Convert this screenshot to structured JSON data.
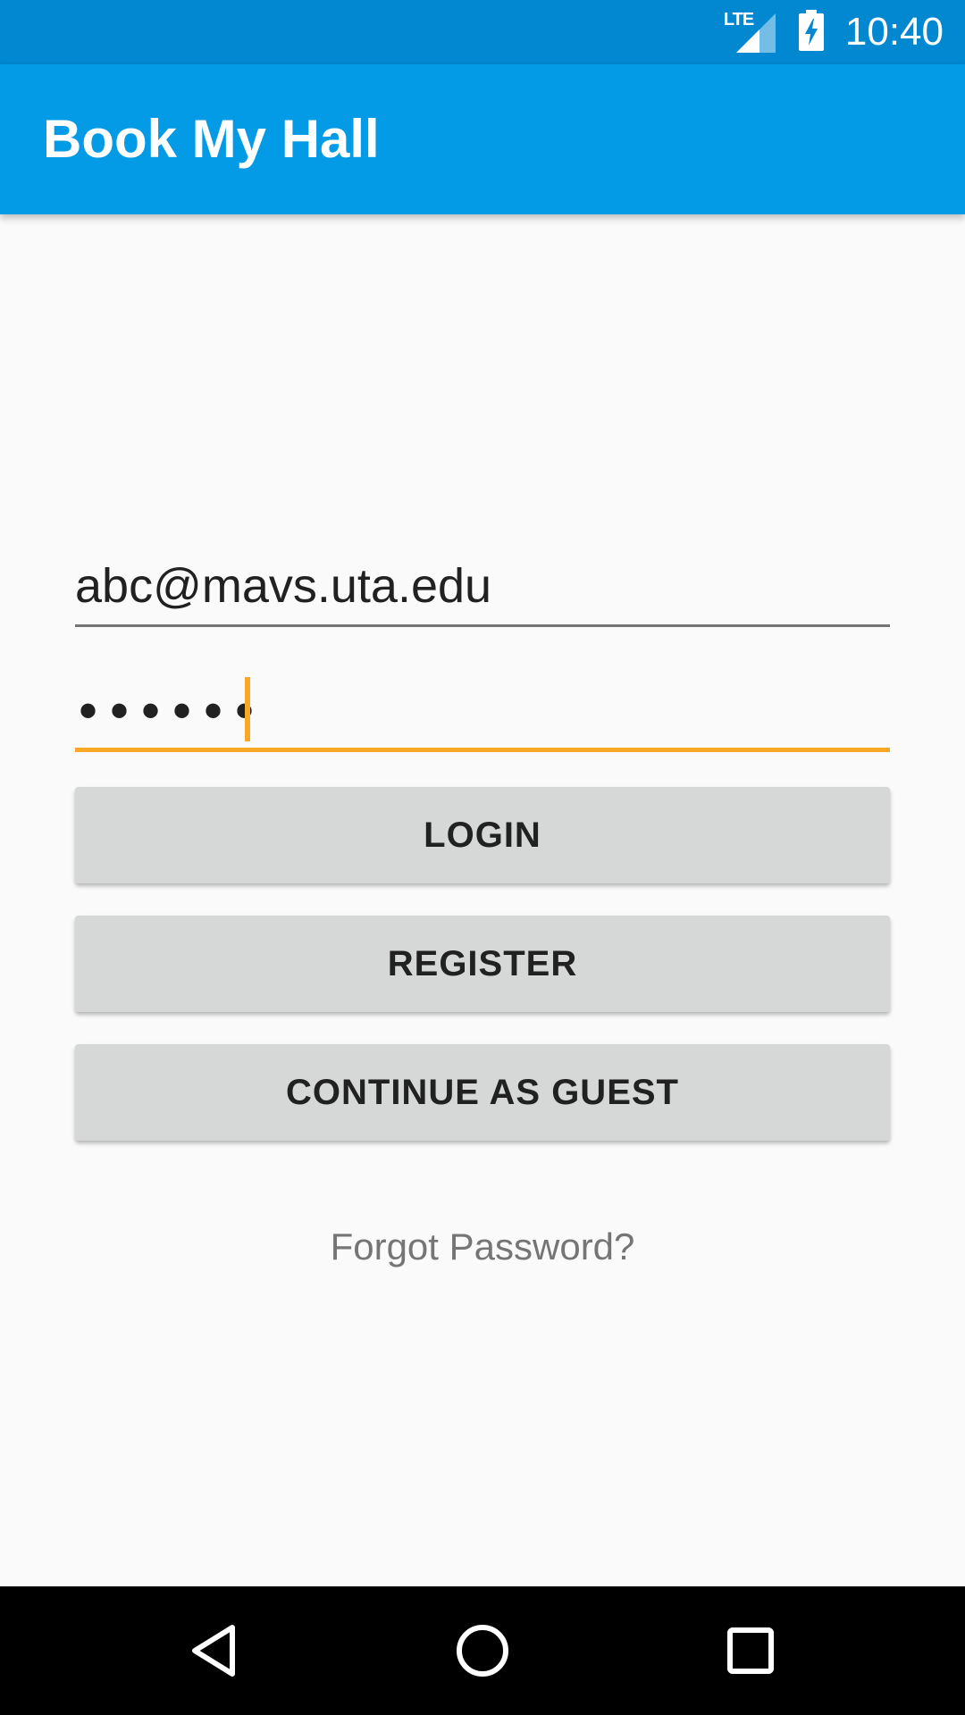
{
  "status_bar": {
    "network_label": "LTE",
    "time": "10:40",
    "icons": [
      "lte-signal-icon",
      "battery-charging-icon"
    ]
  },
  "app_bar": {
    "title": "Book My Hall"
  },
  "login_form": {
    "email_value": "abc@mavs.uta.edu",
    "password_masked": "••••••",
    "buttons": {
      "login": "LOGIN",
      "register": "REGISTER",
      "guest": "CONTINUE AS GUEST"
    },
    "forgot_password": "Forgot Password?"
  },
  "nav_bar": {
    "icons": [
      "back-icon",
      "home-icon",
      "recents-icon"
    ]
  },
  "colors": {
    "status_bar": "#0288d1",
    "app_bar": "#039be5",
    "accent": "#f9a825",
    "button": "#d6d7d7",
    "background": "#fafafa"
  }
}
